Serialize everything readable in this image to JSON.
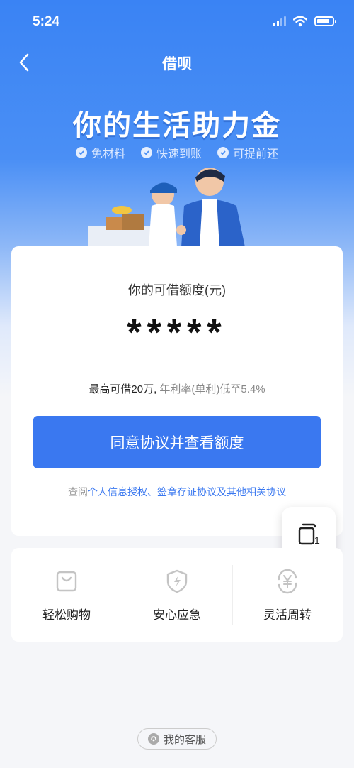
{
  "status_bar": {
    "time": "5:24"
  },
  "nav": {
    "title": "借呗"
  },
  "hero": {
    "headline": "你的生活助力金",
    "features": [
      "免材料",
      "快速到账",
      "可提前还"
    ]
  },
  "limit_card": {
    "label": "你的可借额度(元)",
    "masked_value": "*****",
    "max_text": "最高可借20万,",
    "rate_text": "年利率(单利)低至5.4%",
    "cta_label": "同意协议并查看额度",
    "agreement_prefix": "查阅",
    "agreement_link": "个人信息授权、签章存证协议及其他相关协议"
  },
  "floating_button": {
    "badge": "1"
  },
  "features": [
    {
      "label": "轻松购物",
      "icon": "shopping-bag-icon"
    },
    {
      "label": "安心应急",
      "icon": "shield-lightning-icon"
    },
    {
      "label": "灵活周转",
      "icon": "yuan-cycle-icon"
    }
  ],
  "service": {
    "label": "我的客服"
  },
  "colors": {
    "primary": "#3a78f0",
    "hero_top": "#3a83f4"
  }
}
